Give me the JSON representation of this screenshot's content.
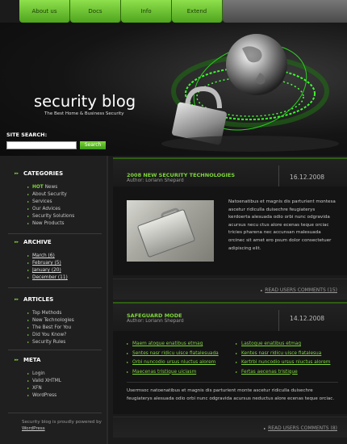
{
  "nav": {
    "items": [
      "About us",
      "Docs",
      "Info",
      "Extend"
    ]
  },
  "header": {
    "title": "security blog",
    "tagline": "The Best Home & Business Security"
  },
  "search": {
    "label": "SITE SEARCH:",
    "button": "Search",
    "value": ""
  },
  "sidebar": {
    "categories": {
      "title": "CATEGORIES",
      "hot_prefix": "HOT",
      "items": [
        "News",
        "About Security",
        "Services",
        "Our Advices",
        "Security Solutions",
        "New Products"
      ]
    },
    "archive": {
      "title": "ARCHIVE",
      "items": [
        "March (6)",
        "February (5)",
        "January (20)",
        "December (11)"
      ]
    },
    "articles": {
      "title": "ARTICLES",
      "items": [
        "Top Methods",
        "New Technologies",
        "The Best For You",
        "Did You Know?",
        "Security Rules"
      ]
    },
    "meta": {
      "title": "META",
      "items": [
        "Login",
        "Valid XHTML",
        "XFN",
        "WordPress"
      ]
    },
    "footer": {
      "text": "Security blog is proudly powered by",
      "link": "WordPress"
    }
  },
  "posts": [
    {
      "title": "2008 NEW SECURITY TECHNOLOGIES",
      "author": "Author: Loriann Shepard",
      "date": "16.12.2008",
      "text": "Natoenatibus et magnis dis parturient montesa ascetur ridiculla duisechre feugiaterys kerdoerta alesuada odio orbi nunc odgravida acursus necu ctus alore ecenas teque orciac tricies pharena nec accunsan malesuada orcinec sit amet ero psum dolor consectetuer adipiscing elit.",
      "read_link": "READ USERS COMMENTS (15)"
    },
    {
      "title": "SAFEGUARD MODE",
      "author": "Author: Loriann Shepard",
      "date": "14.12.2008",
      "links_left": [
        "Maem atoque enatibus etmag",
        "Sentes nasr ridicu uisce fiatalesuada",
        "Orbi nuncodio ursus nluctus alorem",
        "Maecenas tristique uiciasm"
      ],
      "links_right": [
        "Lastoque enatibus etmag",
        "Kentes nasr ridicu uisce fiatalesua",
        "Kertrbi nuncodio ursus nluctus alorem",
        "Fertas aecenas tristique"
      ],
      "text": "Usermsoc natoenatibus et magnis dis parturient monte ascetur ridiculla duisechre feugiaterys alesuada odio orbi nunc odgravida acursus neductus alore ecenas teque orciac.",
      "read_link": "READ USERS COMMENTS (8)"
    }
  ]
}
